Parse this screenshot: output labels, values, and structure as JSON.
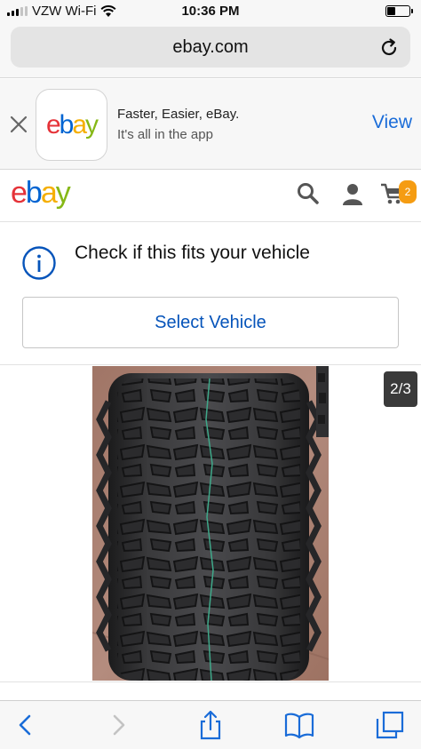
{
  "status_bar": {
    "carrier": "VZW Wi-Fi",
    "time": "10:36 PM"
  },
  "browser": {
    "url": "ebay.com"
  },
  "app_banner": {
    "title": "Faster, Easier, eBay.",
    "subtitle": "It's all in the app",
    "view_label": "View"
  },
  "logo": {
    "letters": [
      "e",
      "b",
      "a",
      "y"
    ],
    "colors": [
      "#e53238",
      "#0064d2",
      "#f5af02",
      "#86b817"
    ]
  },
  "header": {
    "cart_count": "2",
    "icons": [
      "search-icon",
      "user-icon",
      "cart-icon"
    ]
  },
  "fitment": {
    "prompt": "Check if this fits your vehicle",
    "button_label": "Select Vehicle"
  },
  "gallery": {
    "counter": "2/3"
  },
  "toolbar": {
    "icons": [
      "back-icon",
      "forward-icon",
      "share-icon",
      "bookmarks-icon",
      "tabs-icon"
    ]
  },
  "colors": {
    "link_blue": "#1a6cd8",
    "select_text": "#0654ba",
    "badge": "#f59c12"
  }
}
